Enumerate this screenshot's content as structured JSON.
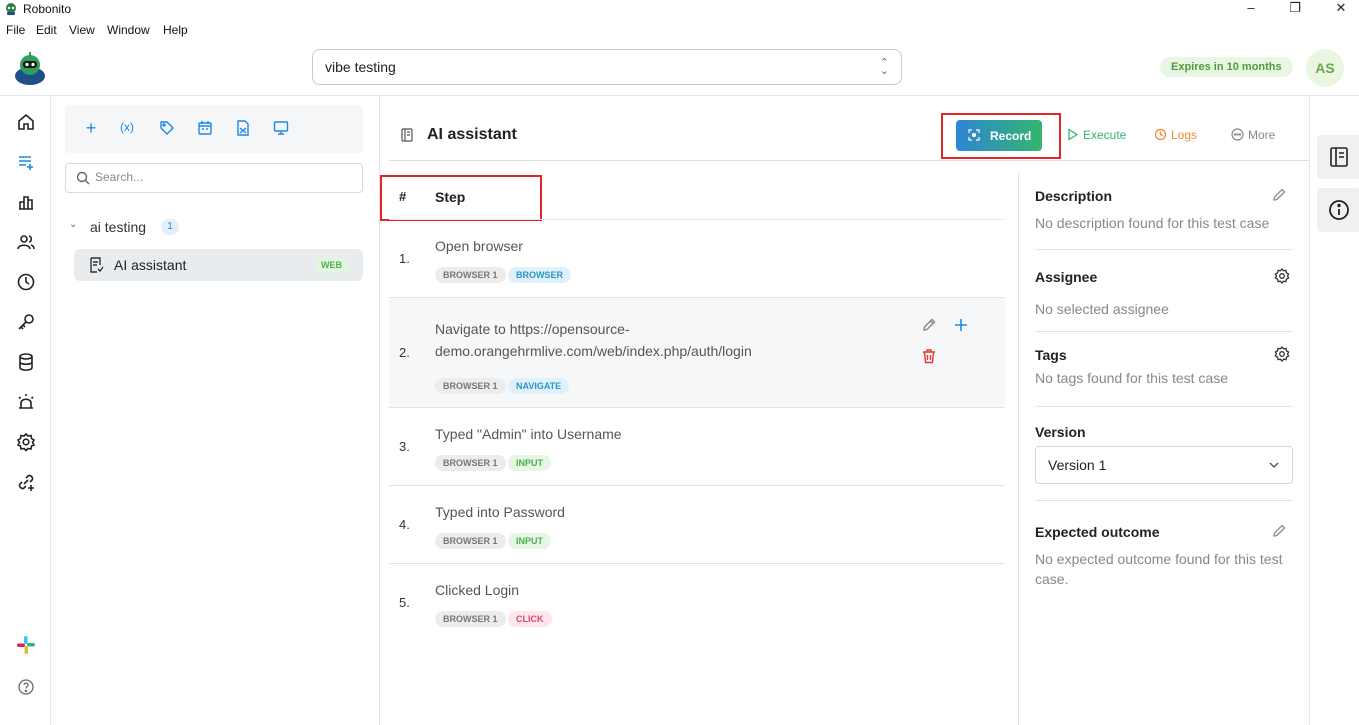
{
  "window": {
    "title": "Robonito"
  },
  "menu": [
    "File",
    "Edit",
    "View",
    "Window",
    "Help"
  ],
  "project": {
    "selected": "vibe testing"
  },
  "license": {
    "expires": "Expires in 10 months"
  },
  "user": {
    "initials": "AS"
  },
  "nav_icons": [
    "home-icon",
    "test-cases-icon",
    "reports-icon",
    "users-icon",
    "history-icon",
    "keys-icon",
    "database-icon",
    "alerts-icon",
    "settings-icon",
    "integrations-icon",
    "slack-icon",
    "help-icon"
  ],
  "sidebar": {
    "tools": [
      "add-icon",
      "variables-icon",
      "tag-icon",
      "schedule-icon",
      "import-icon",
      "environment-icon"
    ],
    "tools_text": {
      "add": "+",
      "variables": "(x)"
    },
    "search_placeholder": "Search...",
    "folder": {
      "name": "ai testing",
      "count": "1"
    },
    "case": {
      "name": "AI assistant",
      "badge": "WEB"
    }
  },
  "main": {
    "title": "AI assistant",
    "buttons": {
      "record": "Record",
      "execute": "Execute",
      "logs": "Logs",
      "more": "More"
    },
    "columns": {
      "num": "#",
      "step": "Step"
    },
    "steps": [
      {
        "num": "1.",
        "text": "Open browser",
        "browser": "BROWSER 1",
        "type": "BROWSER"
      },
      {
        "num": "2.",
        "text": "Navigate to https://opensource-demo.orangehrmlive.com/web/index.php/auth/login",
        "browser": "BROWSER 1",
        "type": "NAVIGATE"
      },
      {
        "num": "3.",
        "text": "Typed \"Admin\" into Username",
        "browser": "BROWSER 1",
        "type": "INPUT"
      },
      {
        "num": "4.",
        "text": "Typed into Password",
        "browser": "BROWSER 1",
        "type": "INPUT"
      },
      {
        "num": "5.",
        "text": "Clicked Login",
        "browser": "BROWSER 1",
        "type": "CLICK"
      }
    ]
  },
  "details": {
    "description": {
      "title": "Description",
      "text": "No description found for this test case"
    },
    "assignee": {
      "title": "Assignee",
      "text": "No selected assignee"
    },
    "tags": {
      "title": "Tags",
      "text": "No tags found for this test case"
    },
    "version": {
      "title": "Version",
      "value": "Version 1"
    },
    "expected": {
      "title": "Expected outcome",
      "text": "No expected outcome found for this test case."
    }
  },
  "colors": {
    "accent": "#1e88e5",
    "record_start": "#2e86d6",
    "record_end": "#34b56d",
    "execute": "#34b56d",
    "logs": "#f08c2d",
    "delete": "#e53935",
    "highlight_frame": "#e12525"
  }
}
